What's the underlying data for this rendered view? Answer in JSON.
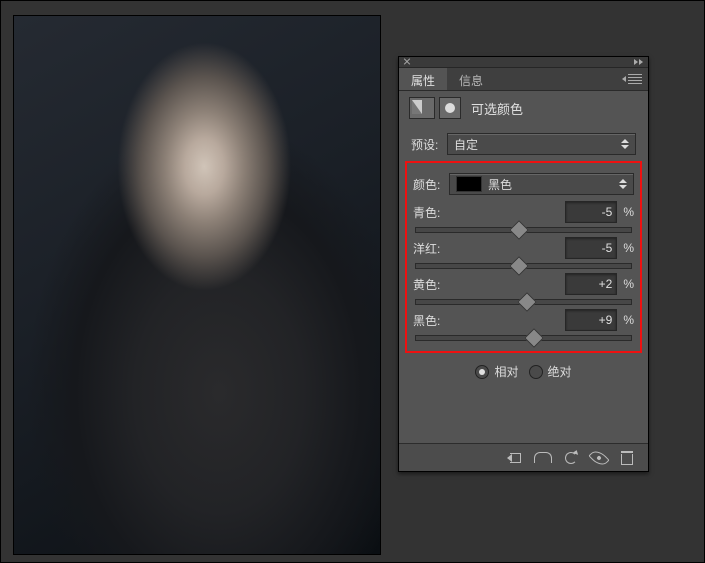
{
  "panel": {
    "tabs": [
      "属性",
      "信息"
    ],
    "adjustment_name": "可选颜色"
  },
  "preset": {
    "label": "预设:",
    "value": "自定"
  },
  "colors": {
    "label": "颜色:",
    "value": "黑色"
  },
  "unit": "%",
  "sliders": [
    {
      "label": "青色:",
      "value": "-5"
    },
    {
      "label": "洋红:",
      "value": "-5"
    },
    {
      "label": "黄色:",
      "value": "+2"
    },
    {
      "label": "黑色:",
      "value": "+9"
    }
  ],
  "method": {
    "options": [
      "相对",
      "绝对"
    ],
    "selected": "相对"
  }
}
